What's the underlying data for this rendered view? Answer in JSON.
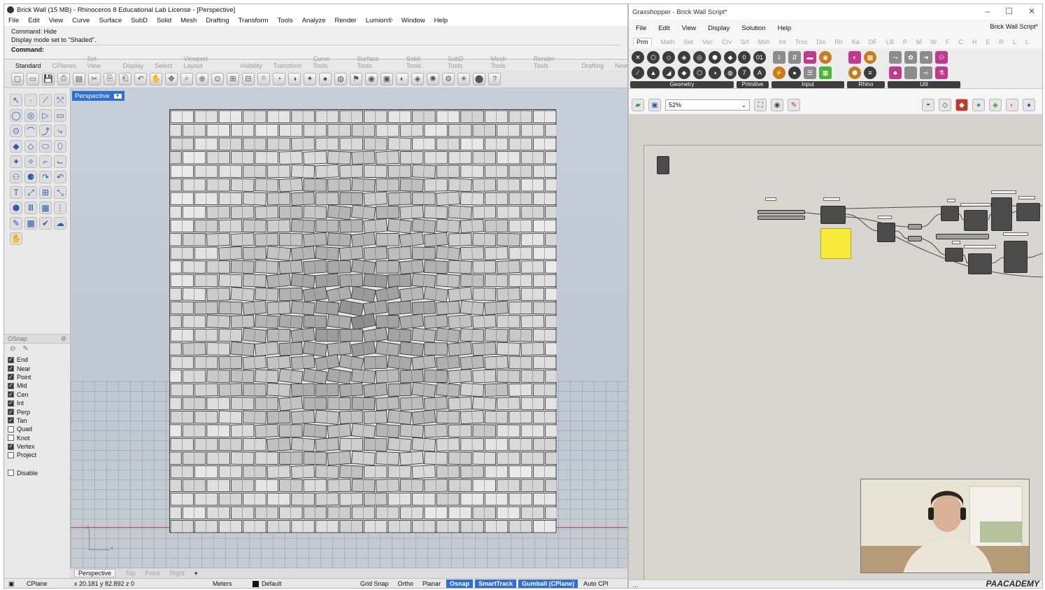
{
  "rhino": {
    "title": "Brick Wall (15 MB) - Rhinoceros 8 Educational Lab License - [Perspective]",
    "menu": [
      "File",
      "Edit",
      "View",
      "Curve",
      "Surface",
      "SubD",
      "Solid",
      "Mesh",
      "Drafting",
      "Transform",
      "Tools",
      "Analyze",
      "Render",
      "Lumion®",
      "Window",
      "Help"
    ],
    "command_history": [
      "Command: Hide",
      "Display mode set to \"Shaded\"."
    ],
    "command_prompt": "Command:",
    "toolbar_tabs": [
      "Standard",
      "CPlanes",
      "Set View",
      "Display",
      "Select",
      "Viewport Layout",
      "Visibility",
      "Transform",
      "Curve Tools",
      "Surface Tools",
      "Solid Tools",
      "SubD Tools",
      "Mesh Tools",
      "Render Tools",
      "Drafting",
      "New"
    ],
    "active_toolbar_tab": "Standard",
    "viewport": {
      "label": "Perspective",
      "tabs": [
        "Perspective",
        "Top",
        "Front",
        "Right"
      ],
      "active_tab": "Perspective",
      "axis_z": "z",
      "axis_x": "x"
    },
    "osnap": {
      "title": "OSnap",
      "items": [
        {
          "label": "End",
          "checked": true
        },
        {
          "label": "Near",
          "checked": true
        },
        {
          "label": "Point",
          "checked": true
        },
        {
          "label": "Mid",
          "checked": true
        },
        {
          "label": "Cen",
          "checked": true
        },
        {
          "label": "Int",
          "checked": true
        },
        {
          "label": "Perp",
          "checked": true
        },
        {
          "label": "Tan",
          "checked": true
        },
        {
          "label": "Quad",
          "checked": false
        },
        {
          "label": "Knot",
          "checked": false
        },
        {
          "label": "Vertex",
          "checked": true
        },
        {
          "label": "Project",
          "checked": false
        }
      ],
      "disable_label": "Disable",
      "disable_checked": false
    },
    "statusbar": {
      "cplane": "CPlane",
      "coords": "x 20.181  y 82.892  z 0",
      "units": "Meters",
      "layer": "Default",
      "toggles": [
        {
          "label": "Grid Snap",
          "on": false
        },
        {
          "label": "Ortho",
          "on": false
        },
        {
          "label": "Planar",
          "on": false
        },
        {
          "label": "Osnap",
          "on": true
        },
        {
          "label": "SmartTrack",
          "on": true
        },
        {
          "label": "Gumball (CPlane)",
          "on": true
        },
        {
          "label": "Auto CPl",
          "on": false
        }
      ]
    }
  },
  "grasshopper": {
    "title": "Grasshopper - Brick Wall Script*",
    "menu": [
      "File",
      "Edit",
      "View",
      "Display",
      "Solution",
      "Help"
    ],
    "document_name": "Brick Wall Script*",
    "tabs": [
      "Prm",
      "Math",
      "Set",
      "Vec",
      "Crv",
      "Srf",
      "Msh",
      "Int",
      "Trns",
      "Dis",
      "Rh",
      "Ka",
      "DF",
      "LB",
      "P",
      "M",
      "W",
      "F",
      "C",
      "H",
      "E",
      "R",
      "L",
      "L"
    ],
    "active_tab": "Prm",
    "ribbon_groups": [
      "Geometry",
      "Primitive",
      "Input",
      "Rhino",
      "Util"
    ],
    "zoom": "52%",
    "branding": "PAACADEMY"
  },
  "colors": {
    "rhino_accent": "#2f6fd1",
    "viewport_bg": "#c4cbd3",
    "gh_canvas": "#d5d3cd",
    "gh_panel_yellow": "#f7ea3a",
    "axis_red": "#b94a4a"
  }
}
